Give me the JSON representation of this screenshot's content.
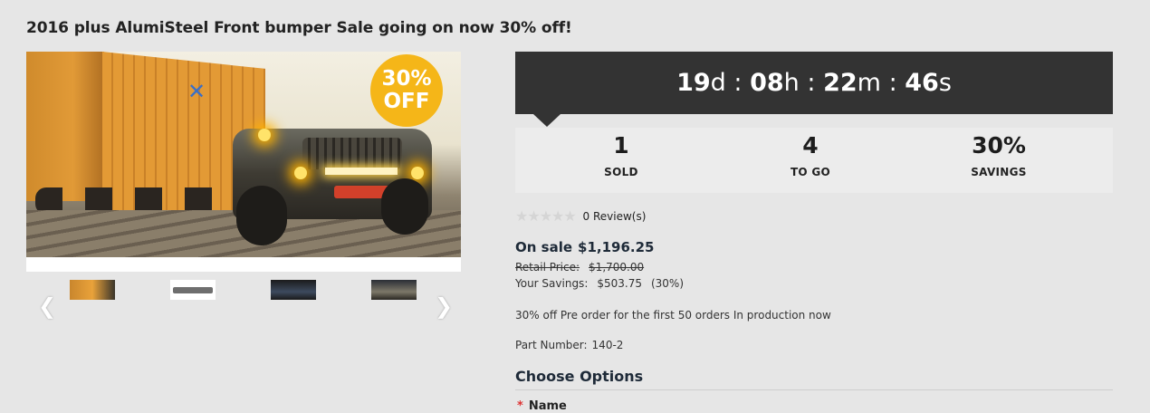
{
  "product": {
    "title": "2016 plus AlumiSteel Front bumper Sale going on now 30% off!",
    "badge_line1": "30%",
    "badge_line2": "OFF"
  },
  "gallery": {
    "prev_icon": "chevron-left-icon",
    "next_icon": "chevron-right-icon",
    "thumbnails": [
      "thumb-1",
      "thumb-2",
      "thumb-3",
      "thumb-4"
    ]
  },
  "countdown": {
    "days": "19",
    "days_unit": "d",
    "hours": "08",
    "hours_unit": "h",
    "minutes": "22",
    "minutes_unit": "m",
    "seconds": "46",
    "seconds_unit": "s",
    "separator": ":"
  },
  "stats": {
    "sold_value": "1",
    "sold_label": "SOLD",
    "togo_value": "4",
    "togo_label": "TO GO",
    "savings_value": "30%",
    "savings_label": "SAVINGS"
  },
  "reviews": {
    "rating": 0,
    "stars": "★★★★★",
    "text": "0 Review(s)"
  },
  "pricing": {
    "on_sale_label": "On sale",
    "on_sale_price": "$1,196.25",
    "retail_label": "Retail Price:",
    "retail_price": "$1,700.00",
    "savings_label": "Your Savings:",
    "savings_amount": "$503.75",
    "savings_percent": "(30%)"
  },
  "description": "30% off Pre order for the first 50 orders In production now",
  "part_number": {
    "label": "Part Number:",
    "value": "140-2"
  },
  "options": {
    "title": "Choose Options",
    "required_mark": "*",
    "first_label": "Name"
  },
  "colors": {
    "background": "#e6e6e6",
    "countdown_bg": "#333333",
    "badge": "#f5b618",
    "title_text": "#1e2a38"
  }
}
